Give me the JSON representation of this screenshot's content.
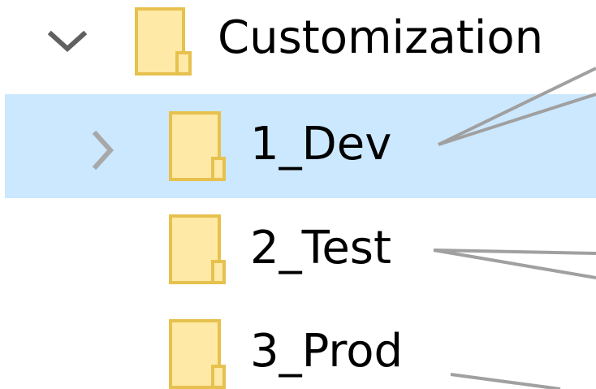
{
  "tree": {
    "parent": {
      "label": "Customization",
      "expand_icon": "chevron-down-icon",
      "folder_icon": "folder-icon"
    },
    "children": [
      {
        "label": "1_Dev",
        "selected": true,
        "expand_icon": "chevron-right-icon",
        "folder_icon": "folder-icon"
      },
      {
        "label": "2_Test",
        "selected": false,
        "folder_icon": "folder-icon"
      },
      {
        "label": "3_Prod",
        "selected": false,
        "folder_icon": "folder-icon"
      }
    ]
  },
  "colors": {
    "selection": "#cce8ff",
    "folder_fill": "#ffe9a6",
    "folder_border": "#e7c14e",
    "chevron": "#606060",
    "connector": "#a0a0a0"
  }
}
